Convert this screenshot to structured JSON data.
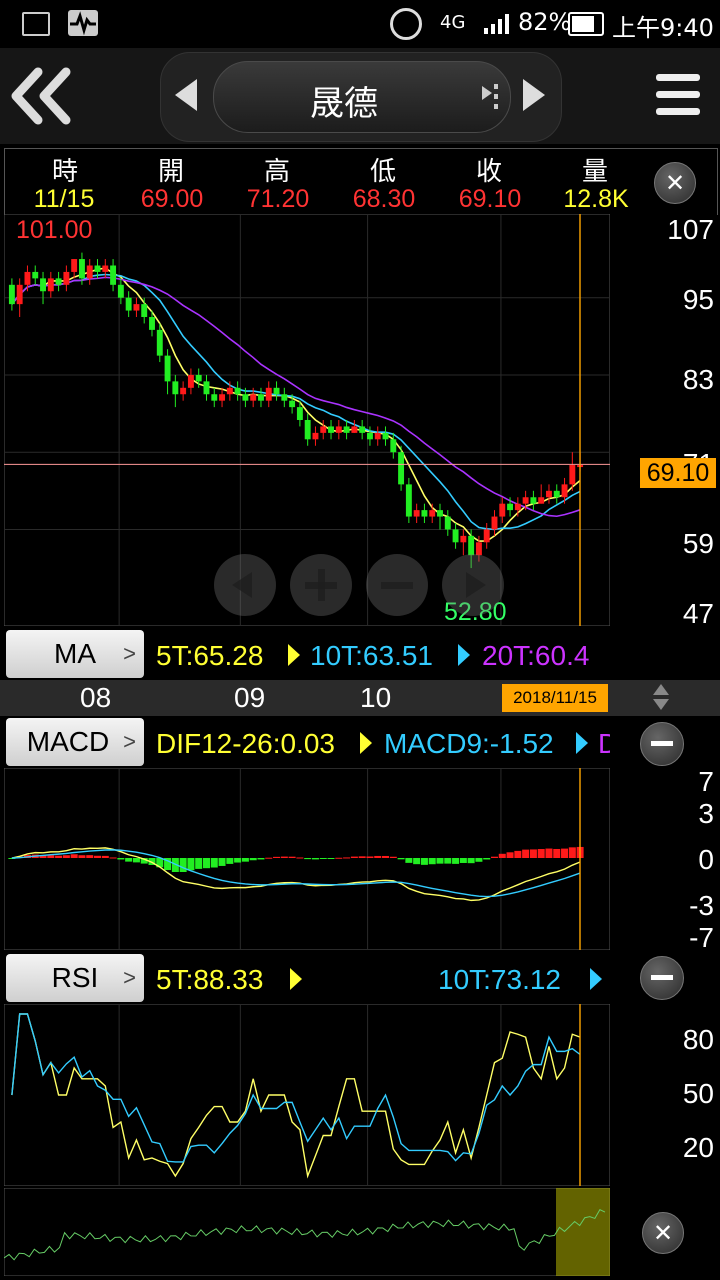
{
  "status": {
    "battery": "82%",
    "network": "4G",
    "time": "上午9:40"
  },
  "header": {
    "stock_name": "晟德"
  },
  "quote": {
    "headers": [
      "時",
      "開",
      "高",
      "低",
      "收",
      "量"
    ],
    "values": [
      "11/15",
      "69.00",
      "71.20",
      "68.30",
      "69.10",
      "12.8K"
    ]
  },
  "price_chart": {
    "high_label": "101.00",
    "low_label": "52.80",
    "current_price": "69.10",
    "y_ticks": [
      "107",
      "95",
      "83",
      "71",
      "59",
      "47"
    ],
    "candles": [
      [
        97,
        94,
        98,
        93
      ],
      [
        94,
        97,
        98,
        92
      ],
      [
        97,
        99,
        100,
        96
      ],
      [
        99,
        98,
        100,
        97
      ],
      [
        98,
        96,
        99,
        94
      ],
      [
        96,
        98,
        99,
        95
      ],
      [
        98,
        97,
        99,
        96
      ],
      [
        97,
        99,
        100,
        96
      ],
      [
        99,
        101,
        101,
        98
      ],
      [
        101,
        98,
        102,
        97
      ],
      [
        98,
        100,
        101,
        97
      ],
      [
        100,
        99,
        101,
        98
      ],
      [
        99,
        100,
        101,
        98
      ],
      [
        100,
        97,
        101,
        96
      ],
      [
        97,
        95,
        98,
        94
      ],
      [
        95,
        93,
        96,
        92
      ],
      [
        93,
        94,
        95,
        92
      ],
      [
        94,
        92,
        95,
        91
      ],
      [
        92,
        90,
        93,
        89
      ],
      [
        90,
        86,
        91,
        85
      ],
      [
        86,
        82,
        87,
        80
      ],
      [
        82,
        80,
        83,
        78
      ],
      [
        80,
        81,
        82,
        79
      ],
      [
        81,
        83,
        84,
        80
      ],
      [
        83,
        82,
        84,
        81
      ],
      [
        82,
        80,
        83,
        79
      ],
      [
        80,
        79,
        81,
        78
      ],
      [
        79,
        80,
        81,
        78
      ],
      [
        80,
        81,
        82,
        79
      ],
      [
        81,
        80,
        82,
        79
      ],
      [
        80,
        79,
        81,
        78
      ],
      [
        79,
        80,
        81,
        78
      ],
      [
        80,
        79,
        81,
        78
      ],
      [
        79,
        81,
        82,
        78
      ],
      [
        81,
        80,
        82,
        79
      ],
      [
        80,
        79,
        81,
        78
      ],
      [
        79,
        78,
        80,
        77
      ],
      [
        78,
        76,
        79,
        75
      ],
      [
        76,
        73,
        77,
        72
      ],
      [
        73,
        74,
        75,
        72
      ],
      [
        74,
        75,
        76,
        73
      ],
      [
        75,
        74,
        76,
        73
      ],
      [
        74,
        75,
        76,
        73
      ],
      [
        75,
        74,
        76,
        73
      ],
      [
        74,
        75,
        76,
        74
      ],
      [
        75,
        74,
        76,
        73
      ],
      [
        74,
        73,
        75,
        72
      ],
      [
        73,
        74,
        75,
        72
      ],
      [
        74,
        73,
        75,
        72
      ],
      [
        73,
        71,
        74,
        70
      ],
      [
        71,
        66,
        72,
        65
      ],
      [
        66,
        61,
        67,
        60
      ],
      [
        61,
        62,
        63,
        60
      ],
      [
        62,
        61,
        63,
        60
      ],
      [
        61,
        62,
        63,
        60
      ],
      [
        62,
        61,
        63,
        59
      ],
      [
        61,
        59,
        62,
        58
      ],
      [
        59,
        57,
        60,
        56
      ],
      [
        57,
        58,
        59,
        55
      ],
      [
        58,
        55,
        59,
        53
      ],
      [
        55,
        57,
        58,
        54
      ],
      [
        57,
        59,
        60,
        56
      ],
      [
        59,
        61,
        62,
        58
      ],
      [
        61,
        63,
        64,
        60
      ],
      [
        63,
        62,
        64,
        61
      ],
      [
        62,
        63,
        64,
        61
      ],
      [
        63,
        64,
        65,
        62
      ],
      [
        64,
        63,
        65,
        62
      ],
      [
        63,
        64,
        66,
        63
      ],
      [
        64,
        65,
        66,
        63
      ],
      [
        65,
        64,
        66,
        63
      ],
      [
        64,
        66,
        67,
        63
      ],
      [
        66,
        69,
        71,
        65
      ],
      [
        69,
        69,
        71,
        68
      ]
    ],
    "indicator": {
      "name": "MA",
      "items": [
        {
          "label": "5T:65.28",
          "color": "#ffff33"
        },
        {
          "label": "10T:63.51",
          "color": "#33ccff"
        },
        {
          "label": "20T:60.4",
          "color": "#cc33ff"
        }
      ]
    }
  },
  "time_axis": {
    "labels": [
      "08",
      "09",
      "10"
    ],
    "current_date": "2018/11/15"
  },
  "macd": {
    "name": "MACD",
    "items": [
      {
        "label": "DIF12-26:0.03",
        "color": "#ffff33"
      },
      {
        "label": "MACD9:-1.52",
        "color": "#33ccff"
      },
      {
        "label": "D",
        "color": "#cc33ff"
      }
    ],
    "y_ticks": [
      "7",
      "3",
      "0",
      "-3",
      "-7"
    ]
  },
  "rsi": {
    "name": "RSI",
    "items": [
      {
        "label": "5T:88.33",
        "color": "#ffff33"
      },
      {
        "label": "10T:73.12",
        "color": "#33ccff"
      }
    ],
    "y_ticks": [
      "80",
      "50",
      "20"
    ]
  },
  "colors": {
    "up": "#ff1a1a",
    "down": "#22ee22",
    "ma5": "#ffff66",
    "ma10": "#33ccff",
    "ma20": "#aa33ff",
    "highlight": "#ffa500"
  }
}
